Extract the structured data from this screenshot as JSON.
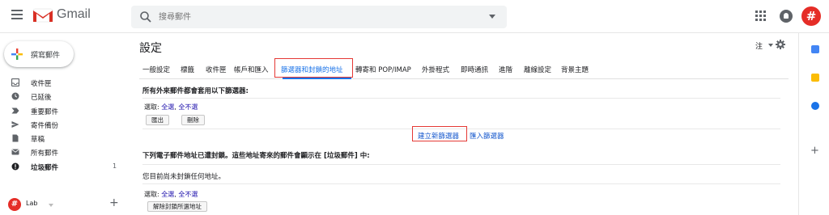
{
  "header": {
    "app_name": "Gmail",
    "search_placeholder": "搜尋郵件",
    "avatar_glyph": "#",
    "colors": {
      "gmail_red": "#d93025",
      "avatar": "#e52d27",
      "accent": "#1a73e8",
      "highlight": "#e53935"
    }
  },
  "sidebar": {
    "compose_label": "撰寫郵件",
    "items": [
      {
        "label": "收件匣",
        "icon": "inbox-icon"
      },
      {
        "label": "已延後",
        "icon": "clock-icon"
      },
      {
        "label": "重要郵件",
        "icon": "important-icon"
      },
      {
        "label": "寄件備份",
        "icon": "send-icon"
      },
      {
        "label": "草稿",
        "icon": "draft-icon"
      },
      {
        "label": "所有郵件",
        "icon": "mail-icon"
      },
      {
        "label": "垃圾郵件",
        "icon": "spam-icon",
        "count": "1"
      }
    ],
    "account": {
      "label": "Lab",
      "avatar_glyph": "#",
      "add": "+"
    }
  },
  "main": {
    "title": "設定",
    "lang_label": "注",
    "tabs": [
      {
        "label": "一般設定"
      },
      {
        "label": "標籤"
      },
      {
        "label": "收件匣"
      },
      {
        "label": "帳戶和匯入"
      },
      {
        "label": "篩選器和封鎖的地址",
        "active": true
      },
      {
        "label": "轉寄和 POP/IMAP"
      },
      {
        "label": "外掛程式"
      },
      {
        "label": "即時通訊"
      },
      {
        "label": "進階"
      },
      {
        "label": "離線設定"
      },
      {
        "label": "背景主題"
      }
    ],
    "filters": {
      "heading": "所有外來郵件都會套用以下篩選器:",
      "select_label": "選取:",
      "select_all": "全選",
      "select_none": "全不選",
      "export_btn": "匯出",
      "delete_btn": "刪除",
      "create_link": "建立新篩選器",
      "import_link": "匯入篩選器"
    },
    "blocked": {
      "heading": "下列電子郵件地址已遭封鎖。這些地址寄來的郵件會顯示在 [垃圾郵件] 中:",
      "empty_text": "您目前尚未封鎖任何地址。",
      "select_label": "選取:",
      "select_all": "全選",
      "select_none": "全不選",
      "unblock_btn": "解除封鎖所選地址"
    }
  },
  "rightbar": {
    "add": "+"
  }
}
